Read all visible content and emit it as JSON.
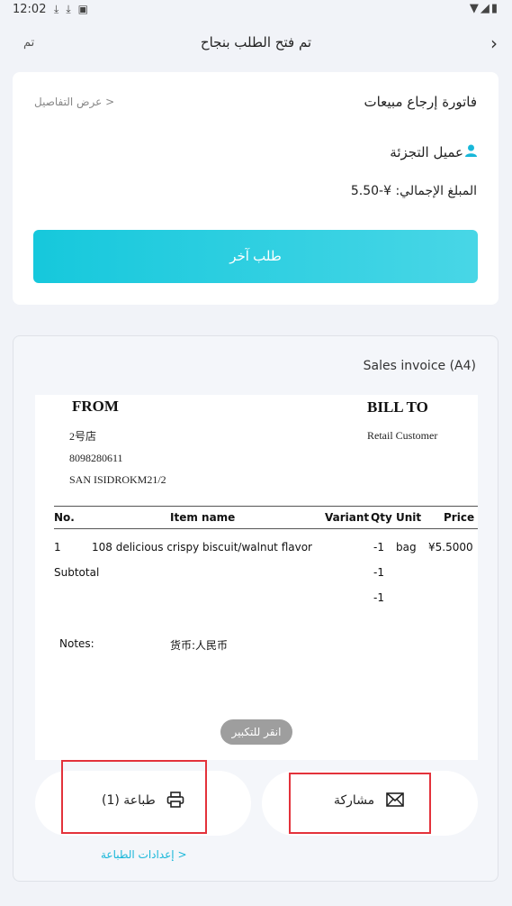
{
  "status_bar": {
    "time": "12:02",
    "left_icons": [
      "download-icon",
      "download-icon",
      "font-icon"
    ],
    "right_icons": [
      "wifi-icon",
      "signal-icon",
      "battery-icon"
    ]
  },
  "header": {
    "done_label": "تم",
    "title": "تم فتح الطلب بنجاح",
    "back_icon": "chevron-right-icon"
  },
  "order_card": {
    "view_details": "عرض التفاصيل >",
    "doc_title": "فاتورة إرجاع مبيعات",
    "customer_name": "عميل التجزئة",
    "total_label": "المبلغ الإجمالي: ¥-5.50",
    "new_order_button": "طلب آخر"
  },
  "invoice_card": {
    "title": "Sales invoice (A4)",
    "preview": {
      "from_heading": "FROM",
      "bill_to_heading": "BILL TO",
      "store_name": "2号店",
      "phone": "8098280611",
      "address": "SAN ISIDROKM21/2",
      "customer": "Retail Customer",
      "columns": [
        "No.",
        "Item name",
        "Variant",
        "Qty",
        "Unit",
        "Price"
      ],
      "rows": [
        {
          "no": "1",
          "item": "108 delicious crispy biscuit/walnut flavor",
          "variant": "",
          "qty": "-1",
          "unit": "bag",
          "price": "¥5.5000"
        }
      ],
      "subtotal_label": "Subtotal",
      "subtotal_qty": "-1",
      "total_qty": "-1",
      "notes_label": "Notes:",
      "notes_value": "货币:人民币",
      "zoom_hint": "انقر للتكبير"
    },
    "print_button": "طباعة (1)",
    "share_button": "مشاركة",
    "print_settings": "إعدادات الطباعة >"
  },
  "colors": {
    "accent": "#18b7d9",
    "highlight": "#e3323b",
    "background": "#f1f3f8"
  }
}
